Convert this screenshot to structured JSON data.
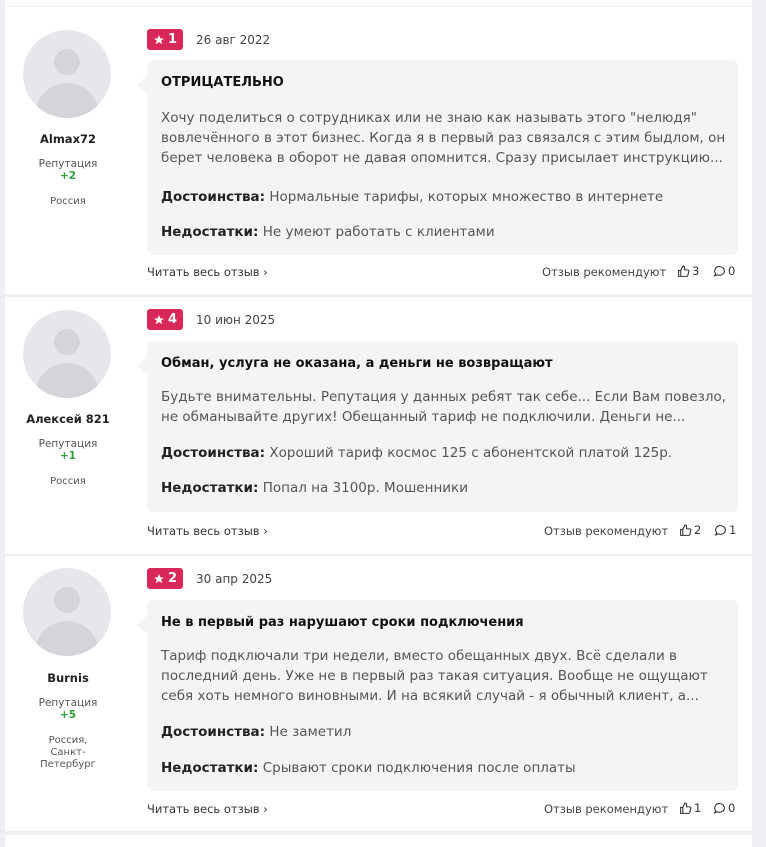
{
  "labels": {
    "reputation": "Репутация",
    "advantages": "Достоинства:",
    "disadvantages": "Недостатки:",
    "read_full": "Читать весь отзыв",
    "recommend": "Отзыв рекомендуют"
  },
  "reviews": [
    {
      "username": "Almax72",
      "reputation": "+2",
      "country": "Россия",
      "rating": "1",
      "date": "26 авг 2022",
      "title": "ОТРИЦАТЕЛЬНО",
      "text": "Хочу поделиться о сотрудниках или не знаю как называть этого \"нелюдя\" вовлечённого в этот бизнес. Когда я в первый раз связался с этим быдлом, он берет человека в оборот не давая опомнится. Сразу присылает инструкцию...",
      "advantages": "Нормальные тарифы, которых множество в интернете",
      "disadvantages": "Не умеют работать с клиентами",
      "likes": "3",
      "comments": "0"
    },
    {
      "username": "Алексей 821",
      "reputation": "+1",
      "country": "Россия",
      "rating": "4",
      "date": "10 июн 2025",
      "title": "Обман, услуга не оказана, а деньги не возвращают",
      "text": "Будьте внимательны. Репутация у данных ребят так себе... Если Вам повезло, не обманывайте других! Обещанный тариф не подключили. Деньги не...",
      "advantages": "Хороший тариф космос 125 с абонентской платой 125р.",
      "disadvantages": "Попал на 3100р. Мошенники",
      "likes": "2",
      "comments": "1"
    },
    {
      "username": "Burnis",
      "reputation": "+5",
      "country": "Россия, Санкт-Петербург",
      "rating": "2",
      "date": "30 апр 2025",
      "title": "Не в первый раз нарушают сроки подключения",
      "text": "Тариф подключали три недели, вместо обещанных двух. Всё сделали в последний день. Уже не в первый раз такая ситуация. Вообще не ощущают себя хоть немного виновными. И на всякий случай - я обычный клиент, а...",
      "advantages": "Не заметил",
      "disadvantages": "Срывают сроки подключения после оплаты",
      "likes": "1",
      "comments": "0"
    }
  ]
}
